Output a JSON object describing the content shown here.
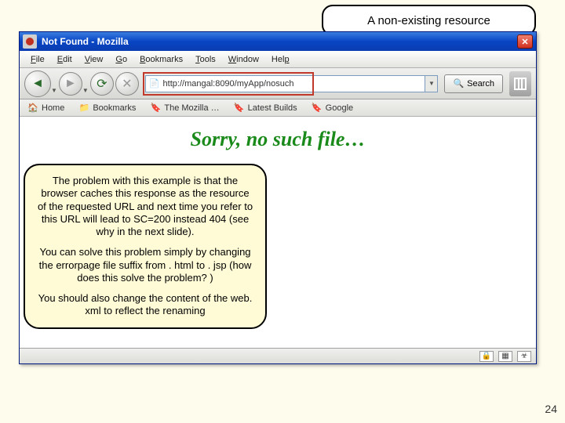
{
  "callout_top": "A non-existing resource",
  "callout_left_p1": "The problem with this example is that the browser caches this response as the resource of the requested URL and next time you refer to this URL will lead to SC=200 instead 404 (see why in the next slide).",
  "callout_left_p2": "You can solve this problem simply by changing the errorpage file suffix from . html to . jsp (how does this solve the problem? )",
  "callout_left_p3": "You should also change the content of the web. xml to reflect the renaming",
  "window": {
    "title": "Not Found - Mozilla"
  },
  "menu": {
    "file": "File",
    "edit": "Edit",
    "view": "View",
    "go": "Go",
    "bookmarks": "Bookmarks",
    "tools": "Tools",
    "window": "Window",
    "help": "Help"
  },
  "url": "http://mangal:8090/myApp/nosuch",
  "search_label": "Search",
  "bookmarks": {
    "home": "Home",
    "bookmarks": "Bookmarks",
    "mozilla": "The Mozilla …",
    "latest": "Latest Builds",
    "google": "Google"
  },
  "page": {
    "heading": "Sorry, no such file…"
  },
  "pagenum": "24"
}
